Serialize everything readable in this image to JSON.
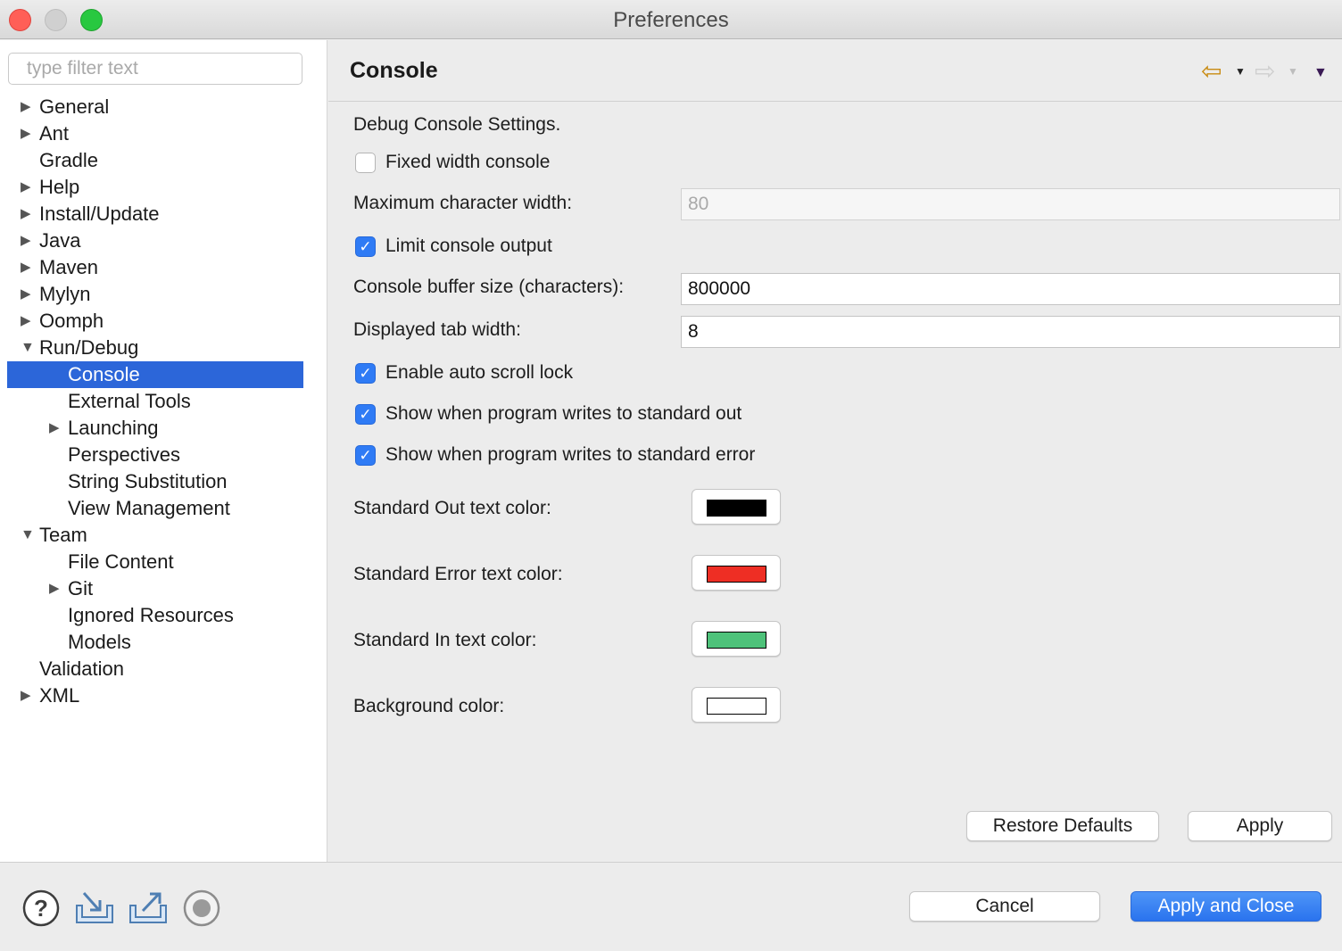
{
  "window": {
    "title": "Preferences"
  },
  "sidebar": {
    "filter_placeholder": "type filter text",
    "tree": [
      {
        "label": "General",
        "level": 0,
        "toggle": "collapsed"
      },
      {
        "label": "Ant",
        "level": 0,
        "toggle": "collapsed"
      },
      {
        "label": "Gradle",
        "level": 0,
        "toggle": "none"
      },
      {
        "label": "Help",
        "level": 0,
        "toggle": "collapsed"
      },
      {
        "label": "Install/Update",
        "level": 0,
        "toggle": "collapsed"
      },
      {
        "label": "Java",
        "level": 0,
        "toggle": "collapsed"
      },
      {
        "label": "Maven",
        "level": 0,
        "toggle": "collapsed"
      },
      {
        "label": "Mylyn",
        "level": 0,
        "toggle": "collapsed"
      },
      {
        "label": "Oomph",
        "level": 0,
        "toggle": "collapsed"
      },
      {
        "label": "Run/Debug",
        "level": 0,
        "toggle": "expanded"
      },
      {
        "label": "Console",
        "level": 1,
        "toggle": "none",
        "selected": true
      },
      {
        "label": "External Tools",
        "level": 1,
        "toggle": "none"
      },
      {
        "label": "Launching",
        "level": 1,
        "toggle": "collapsed"
      },
      {
        "label": "Perspectives",
        "level": 1,
        "toggle": "none"
      },
      {
        "label": "String Substitution",
        "level": 1,
        "toggle": "none"
      },
      {
        "label": "View Management",
        "level": 1,
        "toggle": "none"
      },
      {
        "label": "Team",
        "level": 0,
        "toggle": "expanded"
      },
      {
        "label": "File Content",
        "level": 1,
        "toggle": "none"
      },
      {
        "label": "Git",
        "level": 1,
        "toggle": "collapsed"
      },
      {
        "label": "Ignored Resources",
        "level": 1,
        "toggle": "none"
      },
      {
        "label": "Models",
        "level": 1,
        "toggle": "none"
      },
      {
        "label": "Validation",
        "level": 0,
        "toggle": "none"
      },
      {
        "label": "XML",
        "level": 0,
        "toggle": "collapsed"
      }
    ]
  },
  "header": {
    "title": "Console",
    "back_icon": "back-arrow-icon",
    "forward_icon": "forward-arrow-icon",
    "menu_icon": "view-menu-icon"
  },
  "settings": {
    "intro": "Debug Console Settings.",
    "fixed_width": {
      "label": "Fixed width console",
      "checked": false
    },
    "max_char_width": {
      "label": "Maximum character width:",
      "value": "80",
      "enabled": false
    },
    "limit_output": {
      "label": "Limit console output",
      "checked": true
    },
    "buffer_size": {
      "label": "Console buffer size (characters):",
      "value": "800000"
    },
    "tab_width": {
      "label": "Displayed tab width:",
      "value": "8"
    },
    "auto_scroll_lock": {
      "label": "Enable auto scroll lock",
      "checked": true
    },
    "show_stdout": {
      "label": "Show when program writes to standard out",
      "checked": true
    },
    "show_stderr": {
      "label": "Show when program writes to standard error",
      "checked": true
    },
    "stdout_color": {
      "label": "Standard Out text color:",
      "color": "#000000"
    },
    "stderr_color": {
      "label": "Standard Error text color:",
      "color": "#ee2e24"
    },
    "stdin_color": {
      "label": "Standard In text color:",
      "color": "#4ec27a"
    },
    "background_color": {
      "label": "Background color:",
      "color": "#ffffff"
    }
  },
  "page_buttons": {
    "restore_defaults": "Restore Defaults",
    "apply": "Apply"
  },
  "footer": {
    "cancel": "Cancel",
    "apply_and_close": "Apply and Close",
    "icons": [
      "help-icon",
      "import-icon",
      "export-icon",
      "record-icon"
    ]
  },
  "colors": {
    "selection": "#2c66d9",
    "primary_button": "#2a73ee",
    "accent_back_arrow": "#c98b12"
  }
}
